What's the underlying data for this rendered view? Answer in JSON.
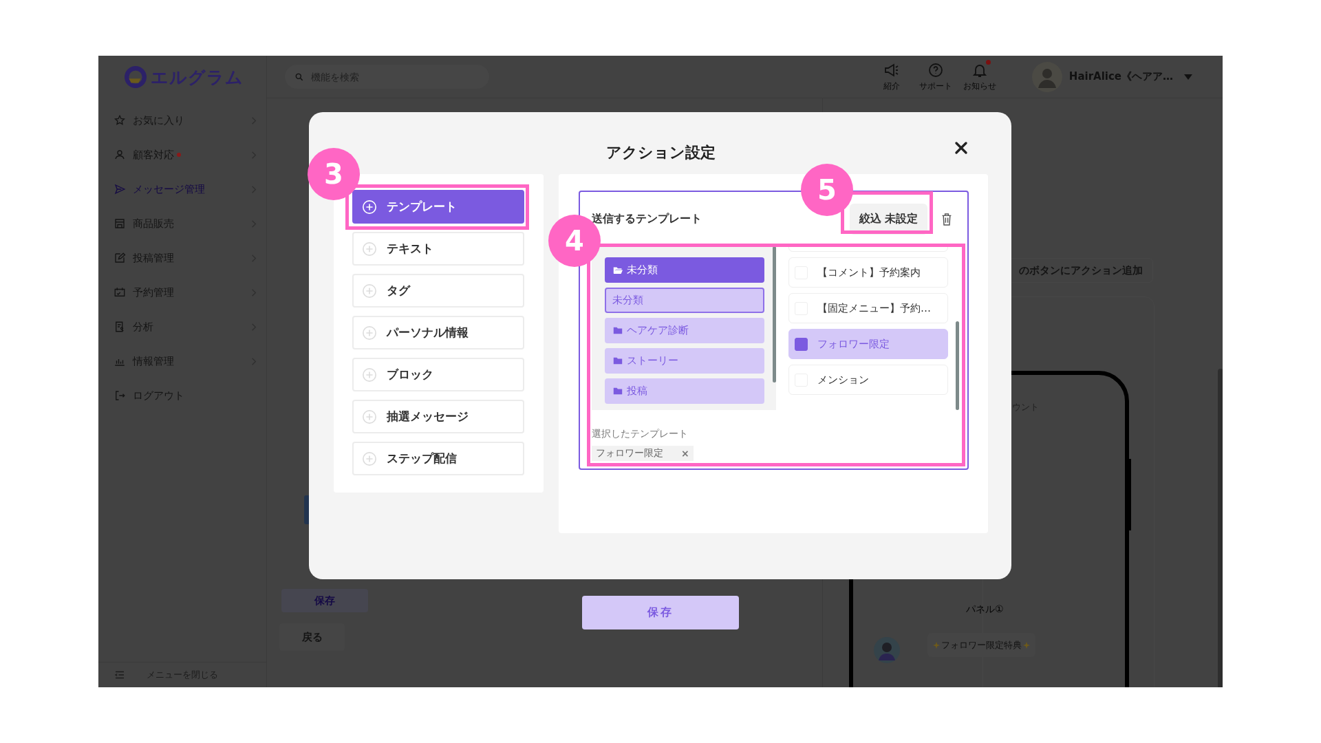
{
  "app": {
    "logo": "エルグラム",
    "search": {
      "placeholder": "機能を検索"
    },
    "top_icons": [
      {
        "label": "紹介",
        "unread": false
      },
      {
        "label": "サポート",
        "unread": false
      },
      {
        "label": "お知らせ",
        "unread": true
      }
    ],
    "user": {
      "name": "HairAlice《ヘアア…"
    }
  },
  "sidebar": {
    "items": [
      {
        "label": "お気に入り",
        "selected": false,
        "alert": false,
        "kind": "menu"
      },
      {
        "label": "顧客対応",
        "selected": false,
        "alert": true,
        "kind": "menu"
      },
      {
        "label": "メッセージ管理",
        "selected": true,
        "alert": false,
        "kind": "menu"
      },
      {
        "label": "商品販売",
        "selected": false,
        "alert": false,
        "kind": "menu"
      },
      {
        "label": "投稿管理",
        "selected": false,
        "alert": false,
        "kind": "menu"
      },
      {
        "label": "予約管理",
        "selected": false,
        "alert": false,
        "kind": "menu"
      },
      {
        "label": "分析",
        "selected": false,
        "alert": false,
        "kind": "menu"
      },
      {
        "label": "情報管理",
        "selected": false,
        "alert": false,
        "kind": "menu"
      },
      {
        "label": "ログアウト",
        "selected": false,
        "alert": false,
        "kind": "link"
      }
    ],
    "collapse": "メニューを閉じる"
  },
  "page": {
    "save": "保存",
    "back": "戻る",
    "add_action": "のボタンにアクション追加",
    "phone_text": "ウント",
    "panel": "パネル①",
    "message": "フォロワー限定特典"
  },
  "modal": {
    "title": "アクション設定",
    "actions": [
      {
        "label": "テンプレート",
        "selected": true
      },
      {
        "label": "テキスト",
        "selected": false
      },
      {
        "label": "タグ",
        "selected": false
      },
      {
        "label": "パーソナル情報",
        "selected": false
      },
      {
        "label": "ブロック",
        "selected": false
      },
      {
        "label": "抽選メッセージ",
        "selected": false
      },
      {
        "label": "ステップ配信",
        "selected": false
      }
    ],
    "template_box": {
      "title": "送信するテンプレート",
      "filter": "絞込 未設定",
      "folders": [
        {
          "label": "未分類",
          "selected": true,
          "kind": "folder"
        },
        {
          "label": "未分類",
          "selected": false,
          "kind": "plain"
        },
        {
          "label": "ヘアケア診断",
          "selected": false,
          "kind": "folder"
        },
        {
          "label": "ストーリー",
          "selected": false,
          "kind": "folder"
        },
        {
          "label": "投稿",
          "selected": false,
          "kind": "folder"
        }
      ],
      "templates": [
        {
          "label": "【コメント】予約案内",
          "checked": false
        },
        {
          "label": "【固定メニュー】予約…",
          "checked": false
        },
        {
          "label": "フォロワー限定",
          "checked": true
        },
        {
          "label": "メンション",
          "checked": false
        }
      ],
      "selected_label": "選択したテンプレート",
      "chips": [
        {
          "label": "フォロワー限定",
          "remove": "×"
        }
      ]
    },
    "save": "保存"
  },
  "annotations": [
    {
      "number": "3"
    },
    {
      "number": "4"
    },
    {
      "number": "5"
    }
  ]
}
